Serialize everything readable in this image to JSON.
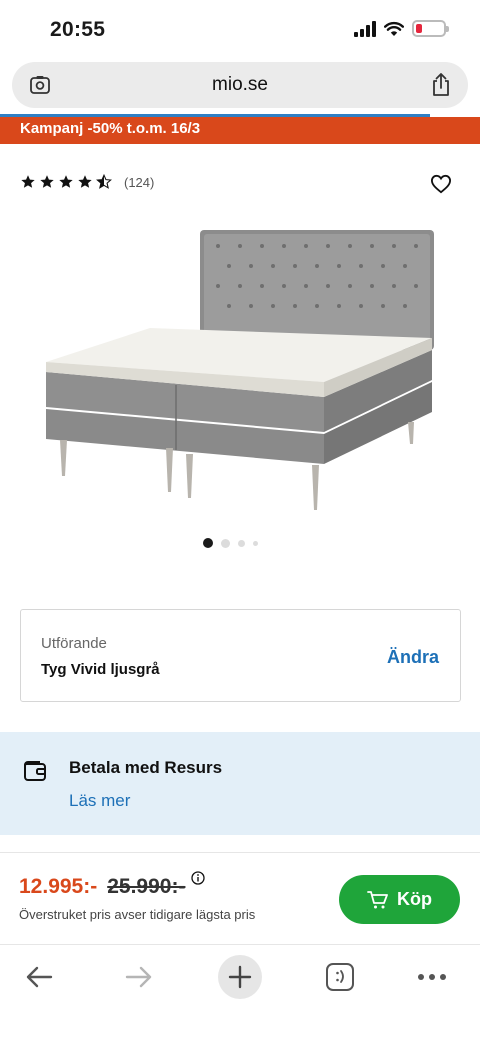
{
  "status_bar": {
    "time": "20:55",
    "battery_color": "#e5263d"
  },
  "browser": {
    "url": "mio.se"
  },
  "promo": {
    "text": "Kampanj -50% t.o.m. 16/3",
    "color": "#d9481b"
  },
  "rating": {
    "stars": 4.5,
    "count": "(124)"
  },
  "carousel": {
    "total": 4,
    "active": 1
  },
  "variant": {
    "label": "Utförande",
    "value": "Tyg Vivid ljusgrå",
    "change_label": "Ändra"
  },
  "resurs": {
    "title": "Betala med Resurs",
    "link": "Läs mer"
  },
  "price": {
    "current": "12.995:-",
    "old": "25.990:-",
    "note": "Överstruket pris avser tidigare lägsta pris"
  },
  "buy": {
    "label": "Köp",
    "color": "#1fa53a"
  },
  "icons": {
    "fav": "heart-outline-icon",
    "wallet": "wallet-icon",
    "cart": "cart-icon",
    "back": "arrow-left-icon",
    "forward": "arrow-right-icon",
    "new_tab": "plus-icon",
    "tabs": "tabs-icon",
    "more": "more-icon"
  }
}
